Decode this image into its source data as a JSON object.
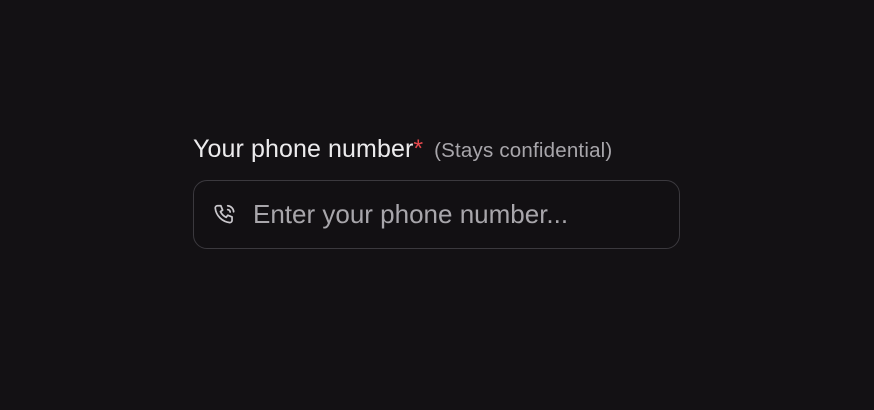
{
  "field": {
    "label": "Your phone number",
    "required_mark": "*",
    "hint": "(Stays confidential)",
    "placeholder": "Enter your phone number...",
    "value": "",
    "icon": "phone-icon"
  },
  "colors": {
    "background": "#131114",
    "label": "#ecebed",
    "required": "#e5484d",
    "hint": "#a8a6ab",
    "border": "#3b393e"
  }
}
